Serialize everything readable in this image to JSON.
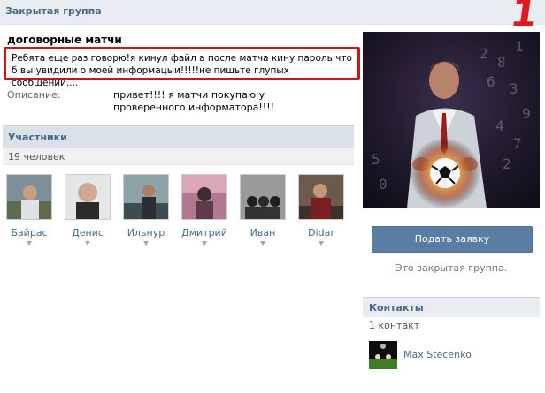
{
  "header": {
    "title": "Закрытая группа",
    "marker": "1"
  },
  "group": {
    "name": "договорные матчи",
    "status": "Ребята еще раз говорю!я кинул файл а после матча кину пароль что б вы увидили о моей информацыи!!!!!не пишьте глупых сообщений....",
    "description_label": "Описание:",
    "description": "привет!!!! я матчи покупаю у проверенного информатора!!!!"
  },
  "members": {
    "title": "Участники",
    "count": "19 человек",
    "items": [
      {
        "name": "Байрас"
      },
      {
        "name": "Денис"
      },
      {
        "name": "Ильнур"
      },
      {
        "name": "Дмитрий"
      },
      {
        "name": "Иван"
      },
      {
        "name": "Didar"
      }
    ]
  },
  "sidebar": {
    "join_button": "Подать заявку",
    "closed_note": "Это закрытая группа.",
    "contacts_title": "Контакты",
    "contacts_count": "1 контакт",
    "contact_name": "Max Stecenko"
  }
}
